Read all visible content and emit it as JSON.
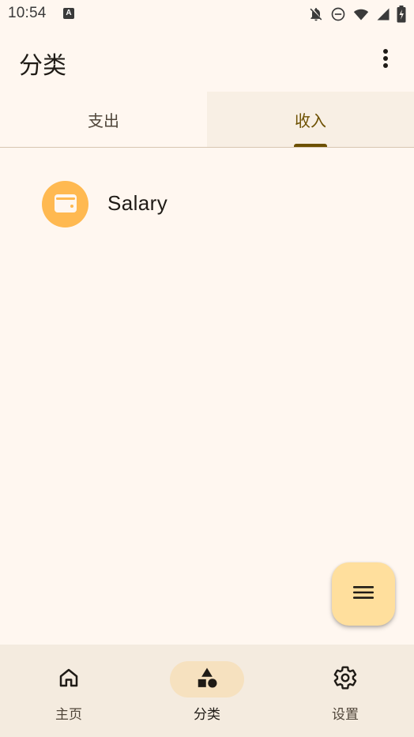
{
  "status_bar": {
    "time": "10:54",
    "app_icon_letter": "A",
    "icons": [
      "notifications-off-icon",
      "do-not-disturb-icon",
      "wifi-icon",
      "signal-icon",
      "battery-charging-icon"
    ]
  },
  "app_bar": {
    "title": "分类",
    "overflow_icon": "more-vert-icon"
  },
  "tabs": [
    {
      "label": "支出",
      "selected": false
    },
    {
      "label": "收入",
      "selected": true
    }
  ],
  "categories": [
    {
      "label": "Salary",
      "icon": "wallet-icon",
      "color": "#ffb951"
    }
  ],
  "fab": {
    "icon": "menu-icon"
  },
  "bottom_nav": [
    {
      "label": "主页",
      "icon": "home-icon",
      "selected": false
    },
    {
      "label": "分类",
      "icon": "category-icon",
      "selected": true
    },
    {
      "label": "设置",
      "icon": "settings-icon",
      "selected": false
    }
  ],
  "colors": {
    "background": "#fff7f0",
    "primary": "#6d5000",
    "avatar": "#ffb951",
    "fab": "#ffdf9d",
    "nav_background": "#f4ebdf",
    "nav_active_pill": "#f6e1bf"
  }
}
